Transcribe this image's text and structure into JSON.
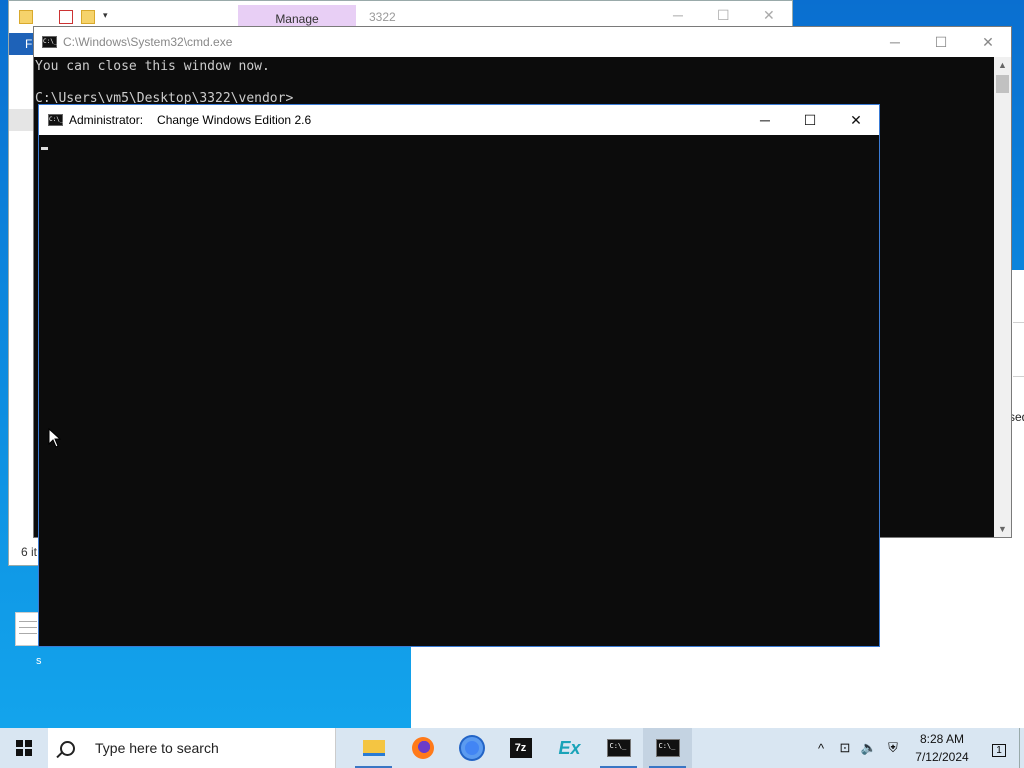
{
  "explorer": {
    "ribbon_tab": "Manage",
    "folder_name": "3322",
    "file_tab": "F",
    "status": "6 it"
  },
  "desktop": {
    "icon_label": "s",
    "background_fragment": "sed"
  },
  "cmd_window": {
    "title": "C:\\Windows\\System32\\cmd.exe",
    "icon_text": "C:\\_",
    "lines": [
      "You can close this window now.",
      "",
      "C:\\Users\\vm5\\Desktop\\3322\\vendor>"
    ]
  },
  "admin_window": {
    "title_prefix": "Administrator:",
    "title": "Change Windows Edition 2.6",
    "icon_text": "C:\\_"
  },
  "window_controls": {
    "minimize": "─",
    "maximize": "☐",
    "close": "✕"
  },
  "taskbar": {
    "search_placeholder": "Type here to search",
    "apps": [
      {
        "name": "File Explorer",
        "icon": "folder-icon"
      },
      {
        "name": "Firefox",
        "icon": "firefox-icon"
      },
      {
        "name": "Chrome",
        "icon": "chrome-icon"
      },
      {
        "name": "7-Zip",
        "icon": "7zip-icon",
        "label": "7z"
      },
      {
        "name": "Ex",
        "icon": "ex-icon",
        "label": "Ex"
      },
      {
        "name": "Command Prompt",
        "icon": "cmd-icon"
      },
      {
        "name": "Command Prompt",
        "icon": "cmd-icon"
      }
    ],
    "tray": {
      "chevron": "^",
      "time": "8:28 AM",
      "date": "7/12/2024",
      "notifications": "1"
    }
  }
}
